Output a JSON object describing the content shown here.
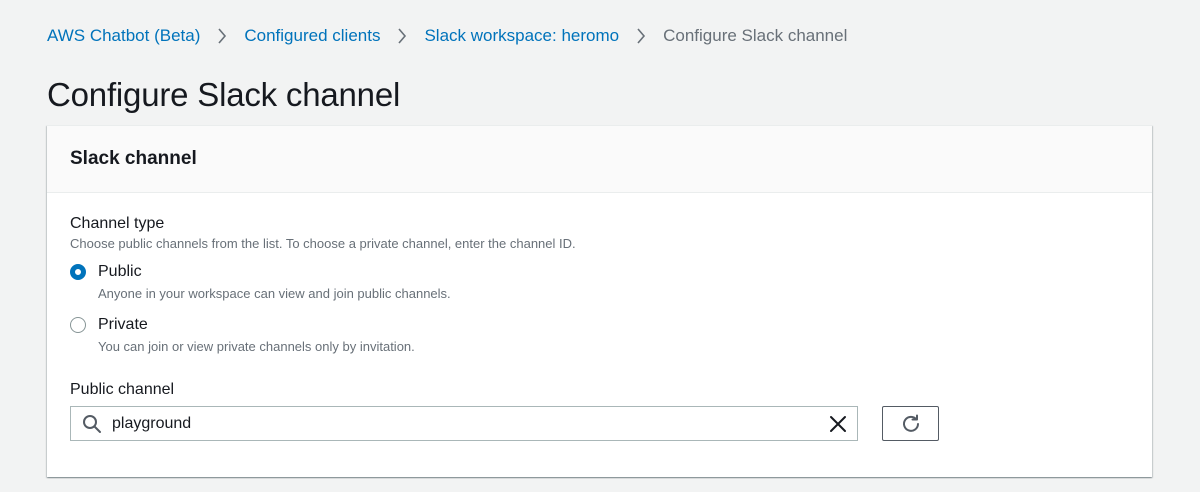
{
  "breadcrumb": {
    "items": [
      {
        "label": "AWS Chatbot (Beta)"
      },
      {
        "label": "Configured clients"
      },
      {
        "label": "Slack workspace: heromo"
      },
      {
        "label": "Configure Slack channel"
      }
    ]
  },
  "page": {
    "title": "Configure Slack channel"
  },
  "panel": {
    "title": "Slack channel",
    "channel_type": {
      "label": "Channel type",
      "description": "Choose public channels from the list. To choose a private channel, enter the channel ID.",
      "options": [
        {
          "label": "Public",
          "description": "Anyone in your workspace can view and join public channels.",
          "selected": true
        },
        {
          "label": "Private",
          "description": "You can join or view private channels only by invitation.",
          "selected": false
        }
      ]
    },
    "public_channel": {
      "label": "Public channel",
      "value": "playground",
      "search_icon": "search-icon",
      "clear_icon": "close-icon",
      "refresh_icon": "refresh-icon"
    }
  },
  "colors": {
    "link": "#0073bb",
    "background": "#f2f3f3",
    "muted_text": "#687078"
  }
}
